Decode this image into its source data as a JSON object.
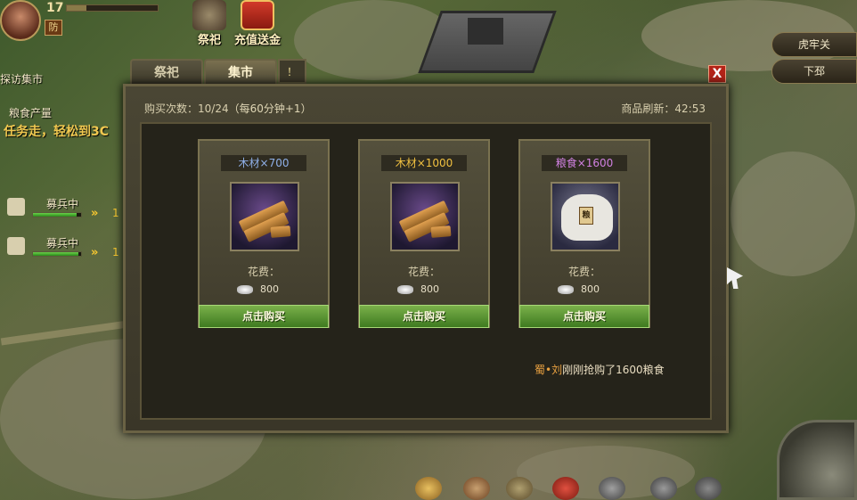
{
  "player": {
    "level": "17",
    "def_badge": "防",
    "exp_progress": 0.22
  },
  "top_menu": {
    "altar": "祭祀",
    "recharge": "充值送金"
  },
  "routes": [
    "虎牢关",
    "下邳"
  ],
  "quests": {
    "visit_market": "探访集市",
    "grain_output": "粮食产量",
    "hint": "任务走，轻松到3C"
  },
  "recruits": [
    {
      "label": "募兵中",
      "count": "1",
      "progress": 0.9
    },
    {
      "label": "募兵中",
      "count": "1",
      "progress": 0.95
    }
  ],
  "tabs": {
    "altar": "祭祀",
    "market": "集市",
    "peek": "！"
  },
  "close": "X",
  "market": {
    "buy_count_label": "购买次数：",
    "buy_count_value": "10/24",
    "buy_count_rate": "（每60分钟+1）",
    "refresh_label": "商品刷新：",
    "refresh_time": "42:53",
    "items": [
      {
        "name": "木材×700",
        "name_color": "#8fb0e8",
        "cost_label": "花费：",
        "cost": "800",
        "button": "点击购买",
        "icon": "wood-icon"
      },
      {
        "name": "木材×1000",
        "name_color": "#f0c040",
        "cost_label": "花费：",
        "cost": "800",
        "button": "点击购买",
        "icon": "wood-icon"
      },
      {
        "name": "粮食×1600",
        "name_color": "#d080e0",
        "cost_label": "花费：",
        "cost": "800",
        "button": "点击购买",
        "icon": "grain-sack-icon"
      }
    ],
    "grain_tag": "粮",
    "log_user": "蜀•刘",
    "log_text": "刚刚抢购了1600粮食"
  }
}
